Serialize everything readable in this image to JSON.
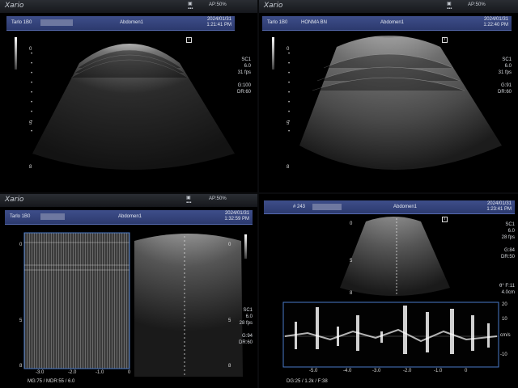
{
  "brand": "Xario",
  "panels": [
    {
      "ap": "AP:50%",
      "patient_id": "Tarlo 1B0",
      "exam": "Abdomen1",
      "date": "2024/01/31",
      "time": "1:21:41 PM",
      "scale": [
        "0",
        "5",
        "8"
      ],
      "params": [
        "SC1",
        "6.0",
        "31 fps",
        "",
        "G:100",
        "DR:60"
      ]
    },
    {
      "ap": "AP:50%",
      "patient_id": "Tarlo 1B0",
      "patient_name": "HONMA BN",
      "exam": "Abdomen1",
      "date": "2024/01/31",
      "time": "1:22:40 PM",
      "scale": [
        "0",
        "5",
        "8"
      ],
      "params": [
        "SC1",
        "6.0",
        "31 fps",
        "",
        "G:91",
        "DR:60"
      ]
    },
    {
      "ap": "AP:50%",
      "patient_id": "Tarlo 1B0",
      "exam": "Abdomen1",
      "date": "2024/01/31",
      "time": "1:32:59 PM",
      "scale_left": [
        "0",
        "5",
        "8"
      ],
      "scale_right": [
        "0",
        "5",
        "8"
      ],
      "params": [
        "SC1",
        "6.0",
        "28 fps",
        "",
        "G:94",
        "DR:60"
      ],
      "mmode_axis": [
        "-3.0",
        "-2.0",
        "-1.0",
        "0"
      ],
      "footer": "MG:75  / MDR:55 / 6.0"
    },
    {
      "patient_id": "# 243",
      "exam": "Abdomen1",
      "date": "2024/01/31",
      "time": "1:23:41 PM",
      "scale": [
        "0",
        "5",
        "8"
      ],
      "params": [
        "SC1",
        "6.0",
        "28 fps",
        "",
        "G:84",
        "DR:50"
      ],
      "gate": [
        "θ° F:11",
        "4.0cm"
      ],
      "doppler_axis": [
        "-5.0",
        "-4.0",
        "-3.0",
        "-2.0",
        "-1.0",
        "0"
      ],
      "doppler_scale": [
        "20",
        "10",
        "cm/s",
        "-10"
      ],
      "footer": "DG:25  / 1.2k  / F:38"
    }
  ],
  "icons": [
    "battery-icon",
    "network-icon",
    "tracker-icon"
  ]
}
